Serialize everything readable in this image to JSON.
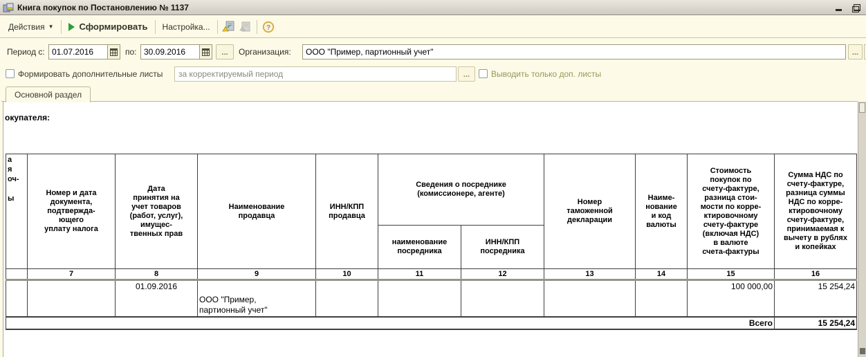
{
  "window": {
    "title": "Книга покупок по Постановлению № 1137"
  },
  "toolbar": {
    "actions_label": "Действия",
    "generate_label": "Сформировать",
    "settings_label": "Настройка..."
  },
  "filters": {
    "period_from_label": "Период с:",
    "period_from_value": "01.07.2016",
    "period_to_label": "по:",
    "period_to_value": "30.09.2016",
    "more_button": "...",
    "org_label": "Организация:",
    "org_value": "ООО \"Пример, партионный учет\"",
    "org_more_button": "...",
    "form_extra_sheets_label": "Формировать дополнительные листы",
    "corr_period_value": "за корректируемый период",
    "corr_more_button": "...",
    "only_extra_sheets_label": "Выводить только доп. листы"
  },
  "tabs": {
    "main_label": "Основной раздел"
  },
  "report": {
    "buyer_fragment": "окупателя:",
    "table": {
      "left_fragment": "а\nя\nоч-\n\nы",
      "headers": {
        "c7": "Номер и дата\nдокумента,\nподтвержда-\nющего\nуплату налога",
        "c8": "Дата\nпринятия на\nучет товаров\n(работ, услуг),\nимущес-\nтвенных прав",
        "c9": "Наименование\nпродавца",
        "c10": "ИНН/КПП\nпродавца",
        "group_intermediary": "Сведения о посреднике\n(комиссионере, агенте)",
        "c11": "наименование\nпосредника",
        "c12": "ИНН/КПП\nпосредника",
        "c13": "Номер\nтаможенной\nдекларации",
        "c14": "Наиме-\nнование\nи код\nвалюты",
        "c15": "Стоимость\nпокупок по\nсчету-фактуре,\nразница стои-\nмости по корре-\nктировочному\nсчету-фактуре\n(включая НДС)\nв валюте\nсчета-фактуры",
        "c16": "Сумма НДС по\nсчету-фактуре,\nразница суммы\nНДС по корре-\nктировочному\nсчету-фактуре,\nпринимаемая к\nвычету в рублях\nи копейках"
      },
      "column_numbers": [
        "7",
        "8",
        "9",
        "10",
        "11",
        "12",
        "13",
        "14",
        "15",
        "16"
      ],
      "row1": {
        "accept_date": "01.09.2016",
        "seller_name": "ООО \"Пример,\nпартионный учет\"",
        "amount": "100 000,00",
        "vat": "15 254,24"
      },
      "totals": {
        "label": "Всего",
        "vat_total": "15 254,24"
      }
    }
  },
  "colors": {
    "form_bg": "#FDFBE7",
    "titlebar_bg": "#D6D2C8",
    "accent_green": "#2E9E3E",
    "disabled_text": "#99945F",
    "table_border": "#3F3F3F"
  }
}
